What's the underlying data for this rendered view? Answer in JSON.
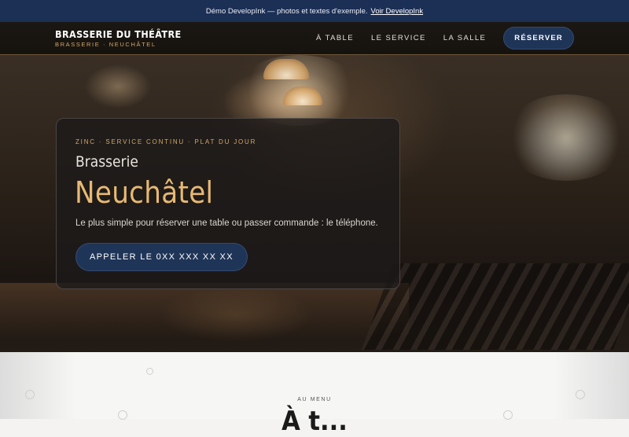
{
  "banner": {
    "text": "Démo DevelopInk — photos et textes d'exemple.",
    "link_label": "Voir DevelopInk"
  },
  "header": {
    "brand_title": "BRASSERIE DU THÉÂTRE",
    "brand_subtitle": "BRASSERIE · NEUCHÂTEL",
    "nav": [
      "À TABLE",
      "LE SERVICE",
      "LA SALLE"
    ],
    "cta_label": "RÉSERVER"
  },
  "hero": {
    "eyebrow": "ZINC · SERVICE CONTINU · PLAT DU JOUR",
    "title_line1": "Brasserie",
    "title_line2": "Neuchâtel",
    "lead": "Le plus simple pour réserver une table ou passer commande : le téléphone.",
    "button_label": "APPELER LE 0XX XXX XX XX"
  },
  "menu_section": {
    "eyebrow": "AU MENU",
    "heading": "À t..."
  },
  "colors": {
    "banner_bg": "#1c2f55",
    "accent_gold": "#d4a868",
    "button_navy": "#1f3558"
  }
}
